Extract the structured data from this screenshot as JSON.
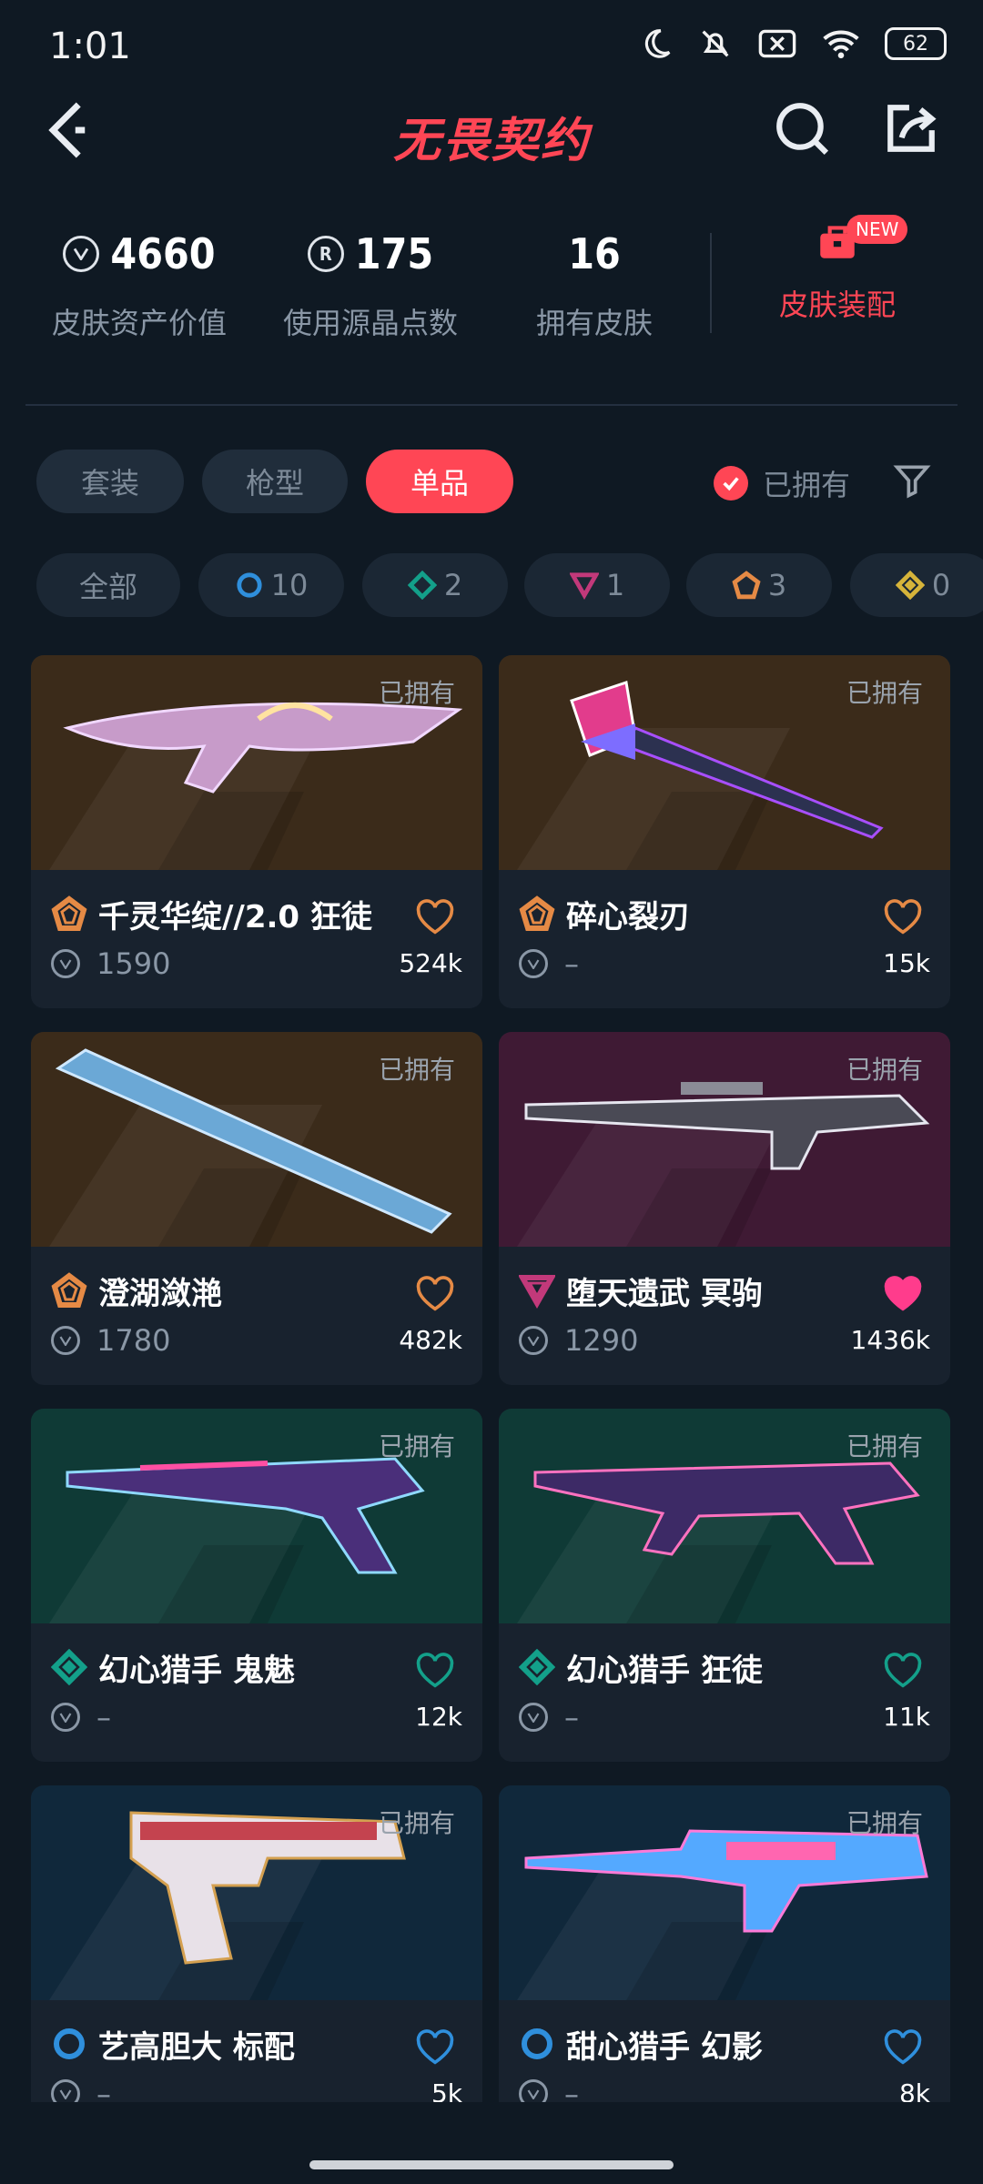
{
  "status_bar": {
    "time": "1:01",
    "battery": "62"
  },
  "header": {
    "title": "无畏契约"
  },
  "stats": [
    {
      "value": "4660",
      "label": "皮肤资产价值",
      "icon": "valorant-points-icon"
    },
    {
      "value": "175",
      "label": "使用源晶点数",
      "icon": "radianite-icon"
    },
    {
      "value": "16",
      "label": "拥有皮肤",
      "icon": ""
    }
  ],
  "equip": {
    "label": "皮肤装配",
    "badge": "NEW"
  },
  "tabs": [
    {
      "label": "套装",
      "active": false
    },
    {
      "label": "枪型",
      "active": false
    },
    {
      "label": "单品",
      "active": true
    }
  ],
  "owned_filter": {
    "label": "已拥有",
    "checked": true
  },
  "tier_chips": [
    {
      "label": "全部"
    },
    {
      "label": "10",
      "tier": "select",
      "color": "#2f8fdc"
    },
    {
      "label": "2",
      "tier": "deluxe",
      "color": "#13a08a"
    },
    {
      "label": "1",
      "tier": "premium",
      "color": "#c2397a"
    },
    {
      "label": "3",
      "tier": "exclusive",
      "color": "#e58a45"
    },
    {
      "label": "0",
      "tier": "ultra",
      "color": "#d6b43a"
    }
  ],
  "owned_tag": "已拥有",
  "cards": [
    {
      "name": "千灵华绽//2.0 狂徒",
      "price": "1590",
      "likes": "524k",
      "tier_color": "#e58a45",
      "heart_color": "#e58a45",
      "heart_filled": false,
      "bg": "#3b2b1a"
    },
    {
      "name": "碎心裂刃",
      "price": "–",
      "likes": "15k",
      "tier_color": "#e58a45",
      "heart_color": "#e58a45",
      "heart_filled": false,
      "bg": "#3b2b1a"
    },
    {
      "name": "澄湖潋滟",
      "price": "1780",
      "likes": "482k",
      "tier_color": "#e58a45",
      "heart_color": "#e58a45",
      "heart_filled": false,
      "bg": "#3b2b1a"
    },
    {
      "name": "堕天遗武 冥驹",
      "price": "1290",
      "likes": "1436k",
      "tier_color": "#c2397a",
      "heart_color": "#ff3c8c",
      "heart_filled": true,
      "bg": "#3f1a34"
    },
    {
      "name": "幻心猎手 鬼魅",
      "price": "–",
      "likes": "12k",
      "tier_color": "#13a08a",
      "heart_color": "#13a08a",
      "heart_filled": false,
      "bg": "#0f3a36"
    },
    {
      "name": "幻心猎手 狂徒",
      "price": "–",
      "likes": "11k",
      "tier_color": "#13a08a",
      "heart_color": "#13a08a",
      "heart_filled": false,
      "bg": "#0f3a36"
    },
    {
      "name": "艺高胆大 标配",
      "price": "–",
      "likes": "5k",
      "tier_color": "#2f8fdc",
      "heart_color": "#2f8fdc",
      "heart_filled": false,
      "bg": "#10283b"
    },
    {
      "name": "甜心猎手 幻影",
      "price": "–",
      "likes": "8k",
      "tier_color": "#2f8fdc",
      "heart_color": "#2f8fdc",
      "heart_filled": false,
      "bg": "#10283b"
    }
  ]
}
